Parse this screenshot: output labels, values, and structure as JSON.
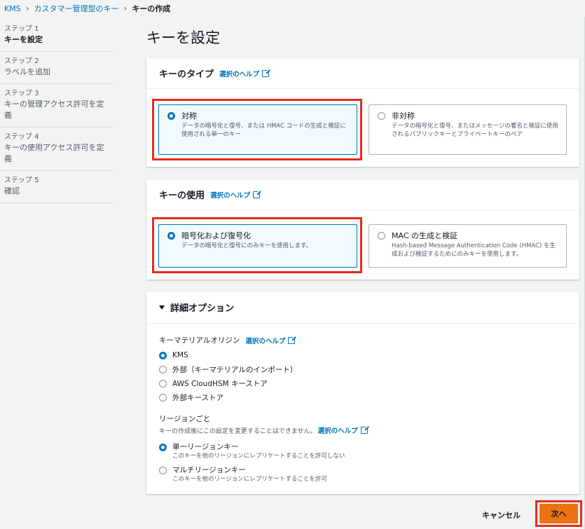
{
  "breadcrumb": {
    "root": "KMS",
    "parent": "カスタマー管理型のキー",
    "current": "キーの作成"
  },
  "steps": [
    {
      "num": "ステップ 1",
      "title": "キーを設定"
    },
    {
      "num": "ステップ 2",
      "title": "ラベルを追加"
    },
    {
      "num": "ステップ 3",
      "title": "キーの管理アクセス許可を定義"
    },
    {
      "num": "ステップ 4",
      "title": "キーの使用アクセス許可を定義"
    },
    {
      "num": "ステップ 5",
      "title": "確認"
    }
  ],
  "page_title": "キーを設定",
  "key_type": {
    "header": "キーのタイプ",
    "info": "選択のヘルプ",
    "options": [
      {
        "title": "対称",
        "desc": "データの暗号化と復号、または HMAC コードの生成と検証に使用される単一のキー",
        "selected": true
      },
      {
        "title": "非対称",
        "desc": "データの暗号化と復号、またはメッセージの署名と検証に使用されるパブリックキーとプライベートキーのペア",
        "selected": false
      }
    ]
  },
  "key_usage": {
    "header": "キーの使用",
    "info": "選択のヘルプ",
    "options": [
      {
        "title": "暗号化および復号化",
        "desc": "データの暗号化と復号にのみキーを使用します。",
        "selected": true
      },
      {
        "title": "MAC の生成と検証",
        "desc": "Hash-based Message Authentication Code (HMAC) を生成および検証するためにのみキーを使用します。",
        "selected": false
      }
    ]
  },
  "advanced": {
    "header": "詳細オプション",
    "origin_label": "キーマテリアルオリジン",
    "origin_info": "選択のヘルプ",
    "origin_options": [
      "KMS",
      "外部（キーマテリアルのインポート）",
      "AWS CloudHSM キーストア",
      "外部キーストア"
    ],
    "region_label": "リージョンごと",
    "region_desc": "キーの作成後にこの設定を変更することはできません。",
    "region_info": "選択のヘルプ",
    "region_options": [
      {
        "title": "単一リージョンキー",
        "desc": "このキーを他のリージョンにレプリケートすることを許可しない"
      },
      {
        "title": "マルチリージョンキー",
        "desc": "このキーを他のリージョンにレプリケートすることを許可"
      }
    ]
  },
  "footer": {
    "cancel": "キャンセル",
    "next": "次へ"
  },
  "colors": {
    "accent": "#0073bb",
    "primary_button": "#ec7211",
    "highlight": "#e52d1c"
  }
}
